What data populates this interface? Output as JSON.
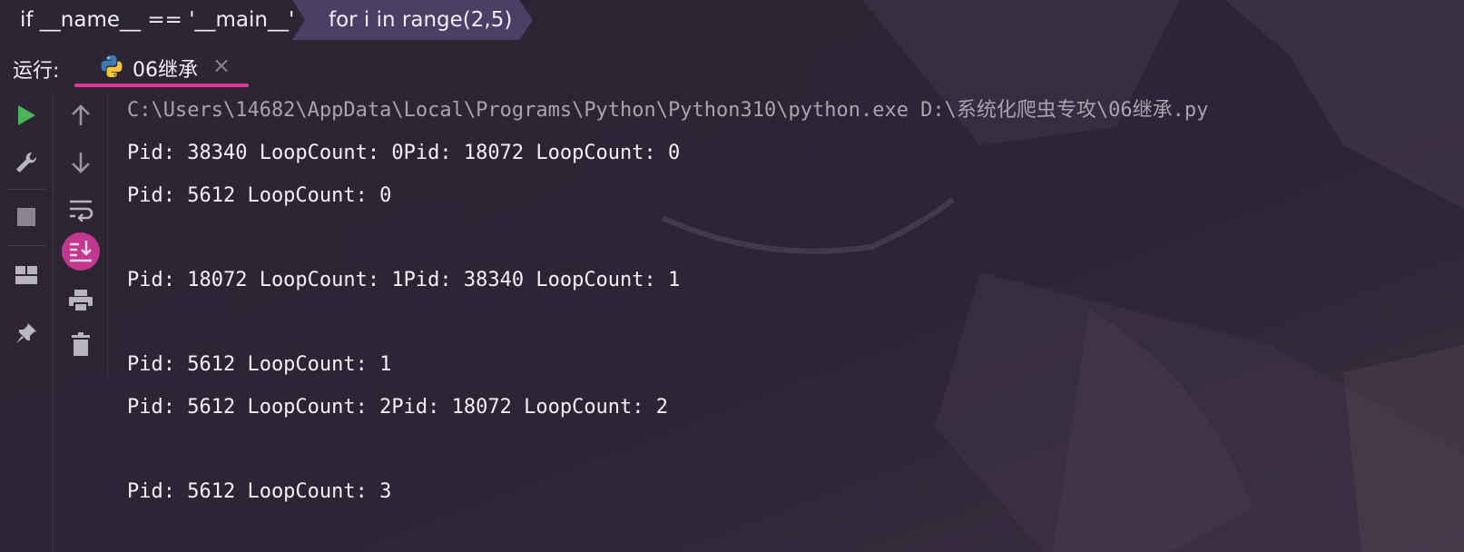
{
  "breadcrumb": {
    "items": [
      {
        "label": "if __name__ == '__main__'"
      },
      {
        "label": "for i in range(2,5)"
      }
    ]
  },
  "run_panel": {
    "label": "运行:",
    "tab": {
      "title": "06继承",
      "icon": "python-icon",
      "close_icon": "close-icon",
      "close_glyph": "×"
    }
  },
  "toolbar_left": [
    {
      "name": "run",
      "icon": "play-icon"
    },
    {
      "name": "settings",
      "icon": "wrench-icon"
    },
    {
      "name": "stop",
      "icon": "stop-icon"
    },
    {
      "name": "layout",
      "icon": "layout-icon"
    },
    {
      "name": "pin",
      "icon": "pin-icon"
    }
  ],
  "toolbar_right": [
    {
      "name": "up",
      "icon": "arrow-up-icon"
    },
    {
      "name": "down",
      "icon": "arrow-down-icon"
    },
    {
      "name": "soft-wrap",
      "icon": "soft-wrap-icon"
    },
    {
      "name": "scroll-to-end",
      "icon": "scroll-to-end-icon",
      "active": true
    },
    {
      "name": "print",
      "icon": "print-icon"
    },
    {
      "name": "clear",
      "icon": "trash-icon"
    }
  ],
  "console": {
    "command": "C:\\Users\\14682\\AppData\\Local\\Programs\\Python\\Python310\\python.exe D:\\系统化爬虫专攻\\06继承.py",
    "lines": [
      "Pid: 38340 LoopCount: 0Pid: 18072 LoopCount: 0",
      "Pid: 5612 LoopCount: 0",
      "",
      "Pid: 18072 LoopCount: 1Pid: 38340 LoopCount: 1",
      "",
      "Pid: 5612 LoopCount: 1",
      "Pid: 5612 LoopCount: 2Pid: 18072 LoopCount: 2",
      "",
      "Pid: 5612 LoopCount: 3"
    ]
  },
  "colors": {
    "background": "#2a2433",
    "accent": "#e0359a",
    "run_green": "#4fb35a",
    "breadcrumb_active": "#4b3f66"
  }
}
